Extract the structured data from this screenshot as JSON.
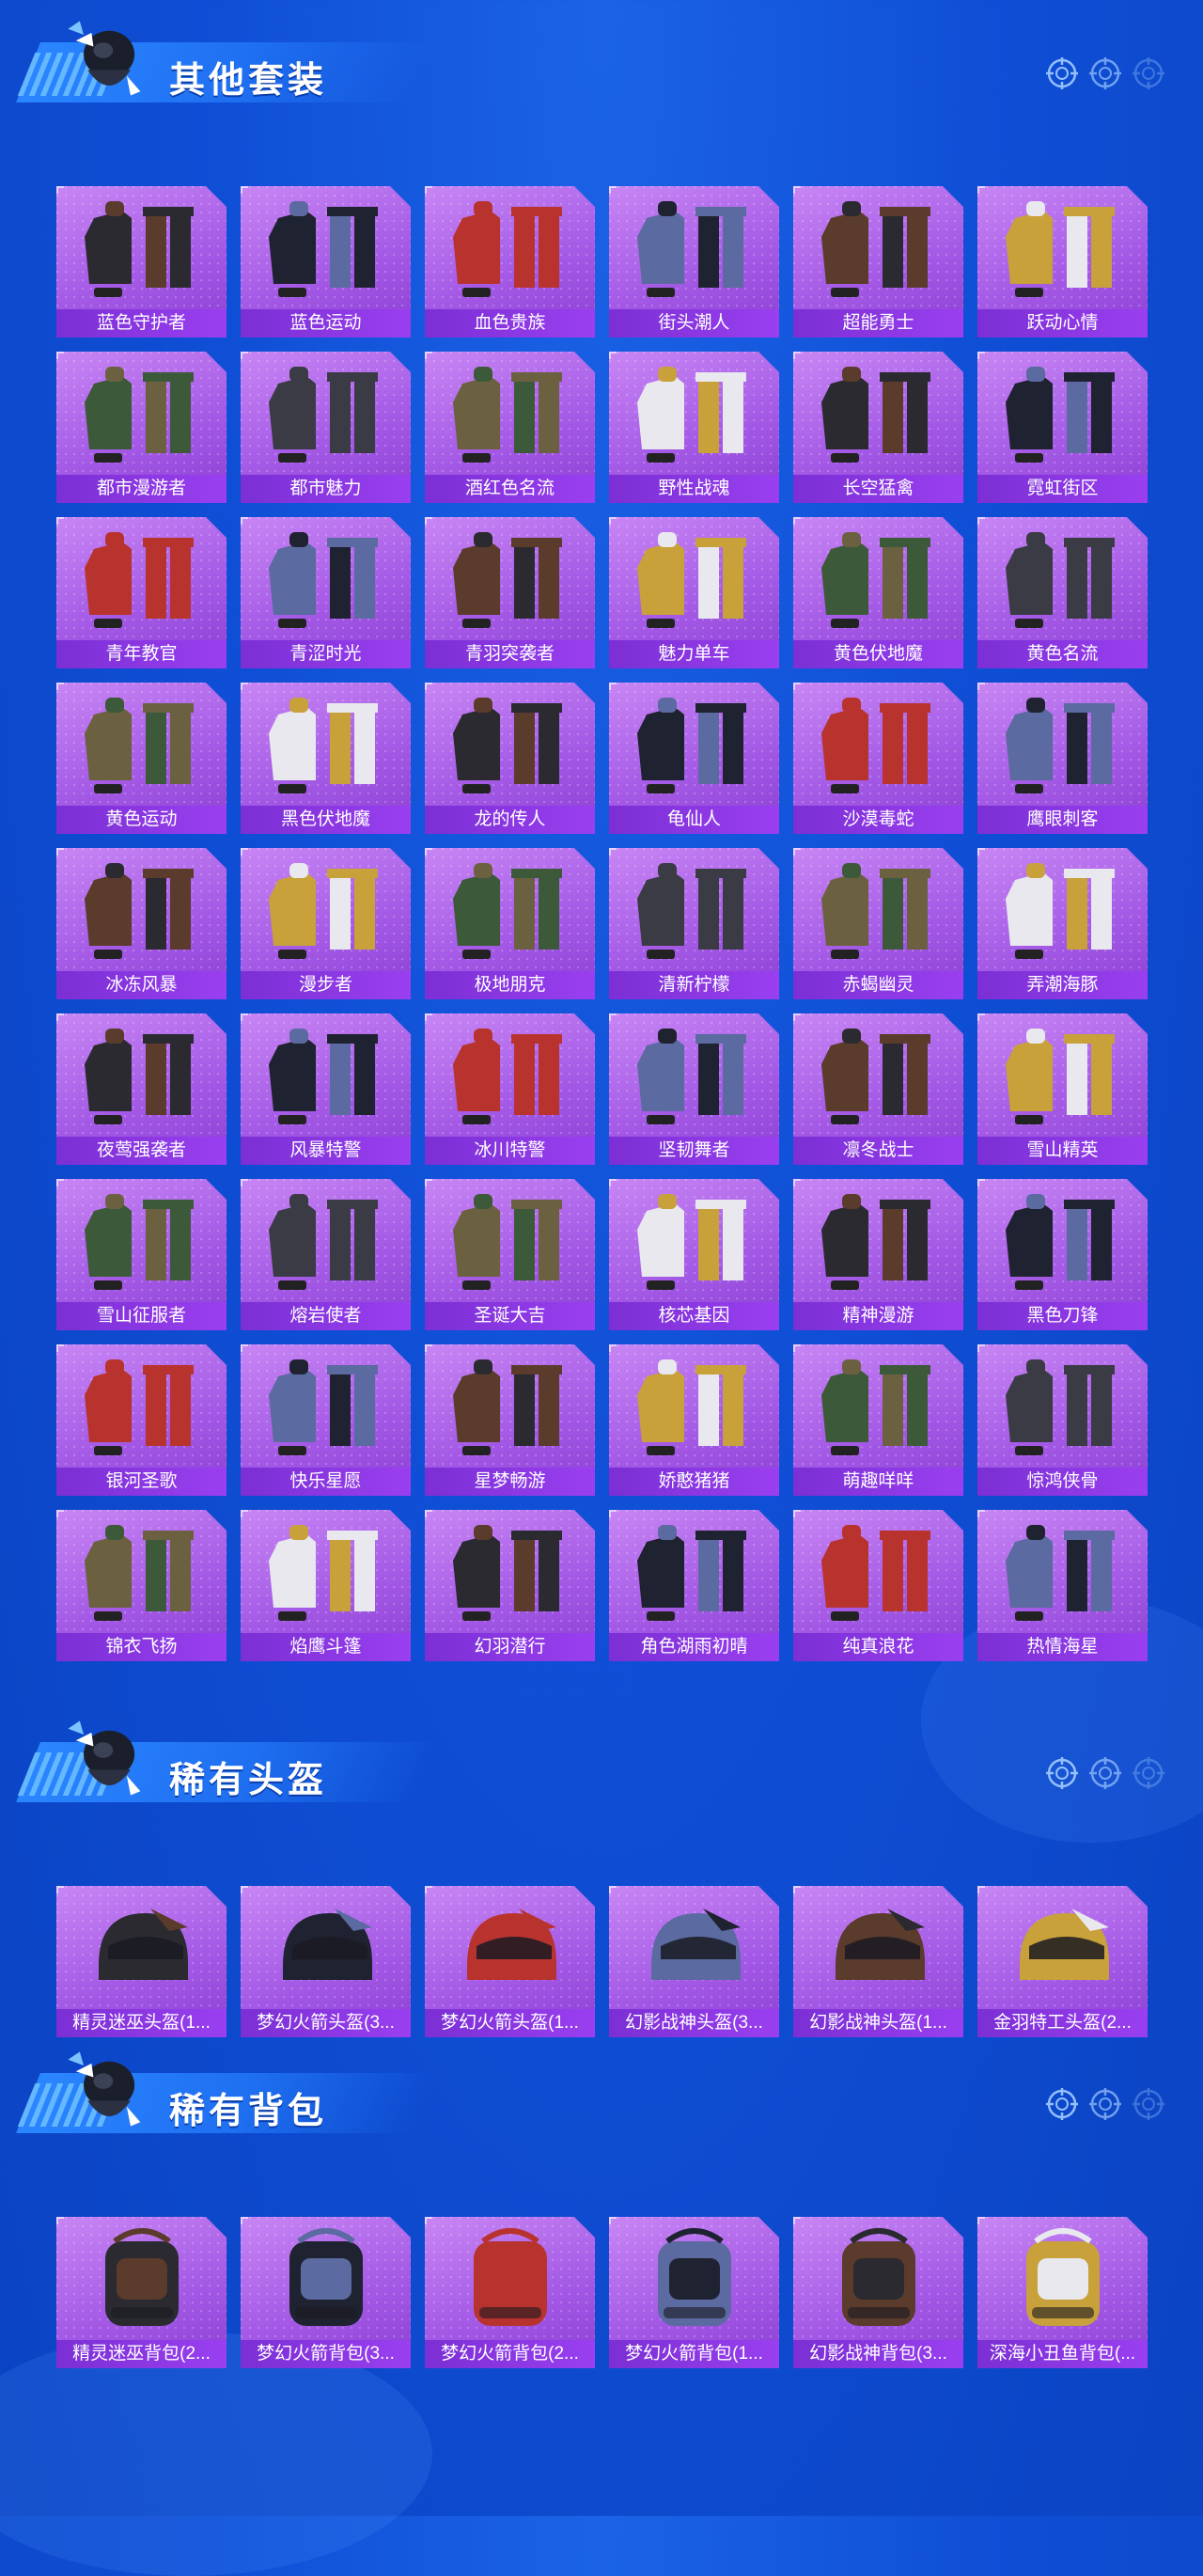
{
  "sections": [
    {
      "title": "其他套装",
      "items": [
        "蓝色守护者",
        "蓝色运动",
        "血色贵族",
        "街头潮人",
        "超能勇士",
        "跃动心情",
        "都市漫游者",
        "都市魅力",
        "酒红色名流",
        "野性战魂",
        "长空猛禽",
        "霓虹街区",
        "青年教官",
        "青涩时光",
        "青羽突袭者",
        "魅力单车",
        "黄色伏地魔",
        "黄色名流",
        "黄色运动",
        "黑色伏地魔",
        "龙的传人",
        "龟仙人",
        "沙漠毒蛇",
        "鹰眼刺客",
        "冰冻风暴",
        "漫步者",
        "极地朋克",
        "清新柠檬",
        "赤蝎幽灵",
        "弄潮海豚",
        "夜莺强袭者",
        "风暴特警",
        "冰川特警",
        "坚韧舞者",
        "凛冬战士",
        "雪山精英",
        "雪山征服者",
        "熔岩使者",
        "圣诞大吉",
        "核芯基因",
        "精神漫游",
        "黑色刀锋",
        "银河圣歌",
        "快乐星愿",
        "星梦畅游",
        "娇憨猪猪",
        "萌趣咩咩",
        "惊鸿侠骨",
        "锦衣飞扬",
        "焰鹰斗篷",
        "幻羽潜行",
        "角色湖雨初晴",
        "纯真浪花",
        "热情海星"
      ]
    },
    {
      "title": "稀有头盔",
      "items": [
        "精灵迷巫头盔(1...",
        "梦幻火箭头盔(3...",
        "梦幻火箭头盔(1...",
        "幻影战神头盔(3...",
        "幻影战神头盔(1...",
        "金羽特工头盔(2..."
      ]
    },
    {
      "title": "稀有背包",
      "items": [
        "精灵迷巫背包(2...",
        "梦幻火箭背包(3...",
        "梦幻火箭背包(2...",
        "梦幻火箭背包(1...",
        "幻影战神背包(3...",
        "深海小丑鱼背包(..."
      ]
    }
  ],
  "icons": {
    "header_mascot": "skydiver-mascot-icon",
    "crosshair": "crosshair-icon"
  },
  "colors": {
    "background": "#0f4fd6",
    "tile": "#a55be6",
    "label_bar": "#8a36e6",
    "banner": "#2a86ff"
  }
}
